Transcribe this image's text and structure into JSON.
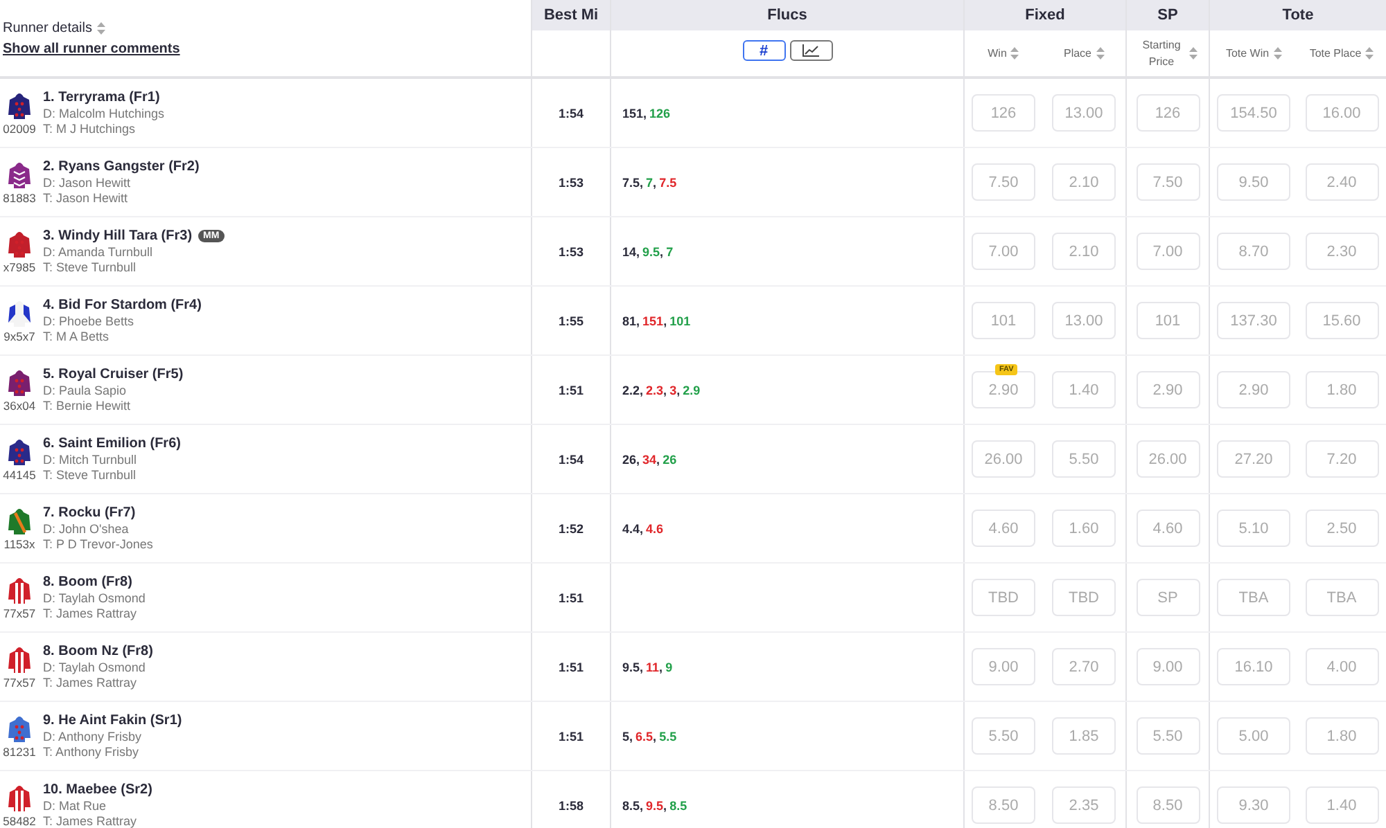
{
  "header": {
    "runner_details": "Runner details",
    "comments_link": "Show all runner comments",
    "best_mi": "Best Mi",
    "flucs": "Flucs",
    "flucs_views": [
      {
        "kind": "number",
        "label": "#",
        "selected": true
      },
      {
        "kind": "chart",
        "selected": false
      }
    ],
    "fixed": "Fixed",
    "fixed_win": "Win",
    "fixed_place": "Place",
    "sp": "SP",
    "starting_price": "Starting Price",
    "tote": "Tote",
    "tote_win": "Tote Win",
    "tote_place": "Tote Place"
  },
  "runners": [
    {
      "name": "1. Terryrama (Fr1)",
      "driver": "D: Malcolm Hutchings",
      "trainer": "T: M J Hutchings",
      "form": "02009",
      "silk": {
        "kind": "spots",
        "color": "#26237a"
      },
      "best_mi": "1:54",
      "flucs": [
        {
          "value": "151",
          "sep": ",",
          "color": "#2b2b3a"
        },
        {
          "value": "126",
          "color": "#22a04a"
        }
      ],
      "fixed_win": "126",
      "fixed_place": "13.00",
      "sp": "126",
      "tote_win": "154.50",
      "tote_place": "16.00"
    },
    {
      "name": "2. Ryans Gangster (Fr2)",
      "driver": "D: Jason Hewitt",
      "trainer": "T: Jason Hewitt",
      "form": "81883",
      "silk": {
        "kind": "hoops",
        "color": "#8a2a8a"
      },
      "best_mi": "1:53",
      "flucs": [
        {
          "value": "7.5",
          "sep": ",",
          "color": "#2b2b3a"
        },
        {
          "value": "7",
          "sep": ",",
          "color": "#22a04a"
        },
        {
          "value": "7.5",
          "color": "#e0262a"
        }
      ],
      "fixed_win": "7.50",
      "fixed_place": "2.10",
      "sp": "7.50",
      "tote_win": "9.50",
      "tote_place": "2.40"
    },
    {
      "name": "3. Windy Hill Tara (Fr3)",
      "badge": "MM",
      "driver": "D: Amanda Turnbull",
      "trainer": "T: Steve Turnbull",
      "form": "x7985",
      "silk": {
        "kind": "spots",
        "color": "#c21f2b"
      },
      "best_mi": "1:53",
      "flucs": [
        {
          "value": "14",
          "sep": ",",
          "color": "#2b2b3a"
        },
        {
          "value": "9.5",
          "sep": ",",
          "color": "#22a04a"
        },
        {
          "value": "7",
          "color": "#22a04a"
        }
      ],
      "fixed_win": "7.00",
      "fixed_place": "2.10",
      "sp": "7.00",
      "tote_win": "8.70",
      "tote_place": "2.30"
    },
    {
      "name": "4. Bid For Stardom (Fr4)",
      "driver": "D: Phoebe Betts",
      "trainer": "T: M A Betts",
      "form": "9x5x7",
      "silk": {
        "kind": "sleeves",
        "color": "#f4f4f4"
      },
      "best_mi": "1:55",
      "flucs": [
        {
          "value": "81",
          "sep": ",",
          "color": "#2b2b3a"
        },
        {
          "value": "151",
          "sep": ",",
          "color": "#e0262a"
        },
        {
          "value": "101",
          "color": "#22a04a"
        }
      ],
      "fixed_win": "101",
      "fixed_place": "13.00",
      "sp": "101",
      "tote_win": "137.30",
      "tote_place": "15.60"
    },
    {
      "name": "5. Royal Cruiser (Fr5)",
      "driver": "D: Paula Sapio",
      "trainer": "T: Bernie Hewitt",
      "form": "36x04",
      "silk": {
        "kind": "spots",
        "color": "#7a1f6e"
      },
      "best_mi": "1:51",
      "flucs": [
        {
          "value": "2.2",
          "sep": ",",
          "color": "#2b2b3a"
        },
        {
          "value": "2.3",
          "sep": ",",
          "color": "#e0262a"
        },
        {
          "value": "3",
          "sep": ",",
          "color": "#e0262a"
        },
        {
          "value": "2.9",
          "color": "#22a04a"
        }
      ],
      "fixed_win": "2.90",
      "fav_badge": "FAV",
      "fixed_place": "1.40",
      "sp": "2.90",
      "tote_win": "2.90",
      "tote_place": "1.80"
    },
    {
      "name": "6. Saint Emilion (Fr6)",
      "driver": "D: Mitch Turnbull",
      "trainer": "T: Steve Turnbull",
      "form": "44145",
      "silk": {
        "kind": "spots",
        "color": "#2a2a8a"
      },
      "best_mi": "1:54",
      "flucs": [
        {
          "value": "26",
          "sep": ",",
          "color": "#2b2b3a"
        },
        {
          "value": "34",
          "sep": ",",
          "color": "#e0262a"
        },
        {
          "value": "26",
          "color": "#22a04a"
        }
      ],
      "fixed_win": "26.00",
      "fixed_place": "5.50",
      "sp": "26.00",
      "tote_win": "27.20",
      "tote_place": "7.20"
    },
    {
      "name": "7. Rocku (Fr7)",
      "driver": "D: John O'shea",
      "trainer": "T: P D Trevor-Jones",
      "form": "1153x",
      "silk": {
        "kind": "sash",
        "color": "#1f7a2a"
      },
      "best_mi": "1:52",
      "flucs": [
        {
          "value": "4.4",
          "sep": ",",
          "color": "#2b2b3a"
        },
        {
          "value": "4.6",
          "color": "#e0262a"
        }
      ],
      "fixed_win": "4.60",
      "fixed_place": "1.60",
      "sp": "4.60",
      "tote_win": "5.10",
      "tote_place": "2.50"
    },
    {
      "name": "8. Boom (Fr8)",
      "driver": "D: Taylah Osmond",
      "trainer": "T: James Rattray",
      "form": "77x57",
      "silk": {
        "kind": "stripes",
        "color": "#d0202a"
      },
      "best_mi": "1:51",
      "fixed_win": "TBD",
      "fixed_place": "TBD",
      "sp": "SP",
      "tote_win": "TBA",
      "tote_place": "TBA"
    },
    {
      "name": "8. Boom Nz (Fr8)",
      "driver": "D: Taylah Osmond",
      "trainer": "T: James Rattray",
      "form": "77x57",
      "silk": {
        "kind": "stripes",
        "color": "#d0202a"
      },
      "best_mi": "1:51",
      "flucs": [
        {
          "value": "9.5",
          "sep": ",",
          "color": "#2b2b3a"
        },
        {
          "value": "11",
          "sep": ",",
          "color": "#e0262a"
        },
        {
          "value": "9",
          "color": "#22a04a"
        }
      ],
      "fixed_win": "9.00",
      "fixed_place": "2.70",
      "sp": "9.00",
      "tote_win": "16.10",
      "tote_place": "4.00"
    },
    {
      "name": "9. He Aint Fakin (Sr1)",
      "driver": "D: Anthony Frisby",
      "trainer": "T: Anthony Frisby",
      "form": "81231",
      "silk": {
        "kind": "spots",
        "color": "#3f6fd0"
      },
      "best_mi": "1:51",
      "flucs": [
        {
          "value": "5",
          "sep": ",",
          "color": "#2b2b3a"
        },
        {
          "value": "6.5",
          "sep": ",",
          "color": "#e0262a"
        },
        {
          "value": "5.5",
          "color": "#22a04a"
        }
      ],
      "fixed_win": "5.50",
      "fixed_place": "1.85",
      "sp": "5.50",
      "tote_win": "5.00",
      "tote_place": "1.80"
    },
    {
      "name": "10. Maebee (Sr2)",
      "driver": "D: Mat Rue",
      "trainer": "T: James Rattray",
      "form": "58482",
      "silk": {
        "kind": "stripes",
        "color": "#d0202a"
      },
      "best_mi": "1:58",
      "flucs": [
        {
          "value": "8.5",
          "sep": ",",
          "color": "#2b2b3a"
        },
        {
          "value": "9.5",
          "sep": ",",
          "color": "#e0262a"
        },
        {
          "value": "8.5",
          "color": "#22a04a"
        }
      ],
      "fixed_win": "8.50",
      "fixed_place": "2.35",
      "sp": "8.50",
      "tote_win": "9.30",
      "tote_place": "1.40"
    }
  ]
}
